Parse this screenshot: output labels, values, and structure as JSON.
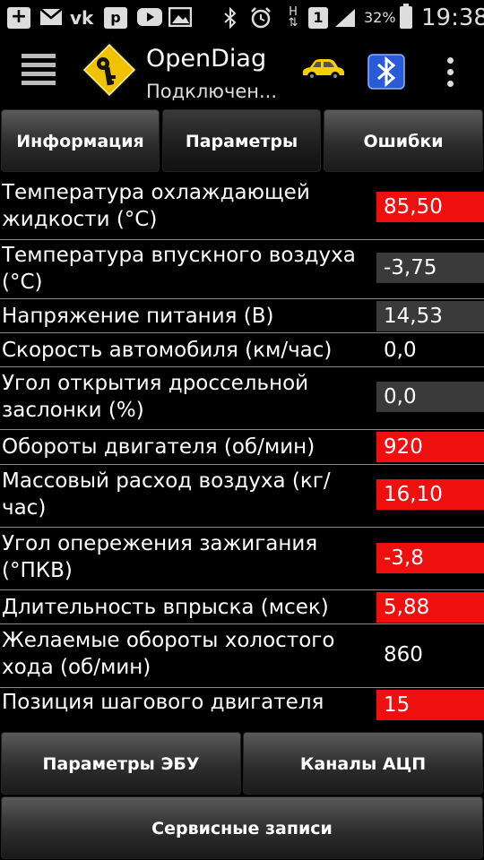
{
  "statusbar": {
    "battery_percent": "32%",
    "time": "19:38",
    "sim_badge": "1",
    "notification_icons": [
      "plus-icon",
      "mail-icon",
      "vk-icon",
      "p-icon",
      "youtube-icon",
      "gallery-icon"
    ],
    "system_icons": [
      "bluetooth-icon",
      "alarm-icon",
      "data-arrows-icon",
      "sim-icon",
      "signal-icon",
      "battery-icon"
    ]
  },
  "appbar": {
    "title": "OpenDiag",
    "subtitle": "Подключен..."
  },
  "tabs": [
    {
      "label": "Информация",
      "active": false
    },
    {
      "label": "Параметры",
      "active": true
    },
    {
      "label": "Ошибки",
      "active": false
    }
  ],
  "parameters": [
    {
      "label": "Температура охлаждающей жидкости (°C)",
      "value": "85,50",
      "status": "red"
    },
    {
      "label": "Температура впускного воздуха (°C)",
      "value": "-3,75",
      "status": "gray"
    },
    {
      "label": "Напряжение питания (В)",
      "value": "14,53",
      "status": "gray"
    },
    {
      "label": "Скорость автомобиля (км/час)",
      "value": "0,0",
      "status": "none"
    },
    {
      "label": "Угол открытия дроссельной заслонки (%)",
      "value": "0,0",
      "status": "gray"
    },
    {
      "label": "Обороты двигателя (об/мин)",
      "value": "920",
      "status": "red"
    },
    {
      "label": "Массовый расход воздуха (кг/час)",
      "value": "16,10",
      "status": "red"
    },
    {
      "label": "Угол опережения зажигания (°ПКВ)",
      "value": "-3,8",
      "status": "red"
    },
    {
      "label": "Длительность впрыска (мсек)",
      "value": "5,88",
      "status": "red"
    },
    {
      "label": "Желаемые обороты холостого хода (об/мин)",
      "value": "860",
      "status": "none"
    },
    {
      "label": "Позиция шагового двигателя",
      "value": "15",
      "status": "red"
    }
  ],
  "bottom_buttons": {
    "ecu_params": "Параметры ЭБУ",
    "adc_channels": "Каналы АЦП",
    "service_records": "Сервисные записи"
  },
  "colors": {
    "alert_red": "#ef0f0f",
    "neutral_gray": "#3a3a3a",
    "logo_yellow": "#f2c200"
  }
}
